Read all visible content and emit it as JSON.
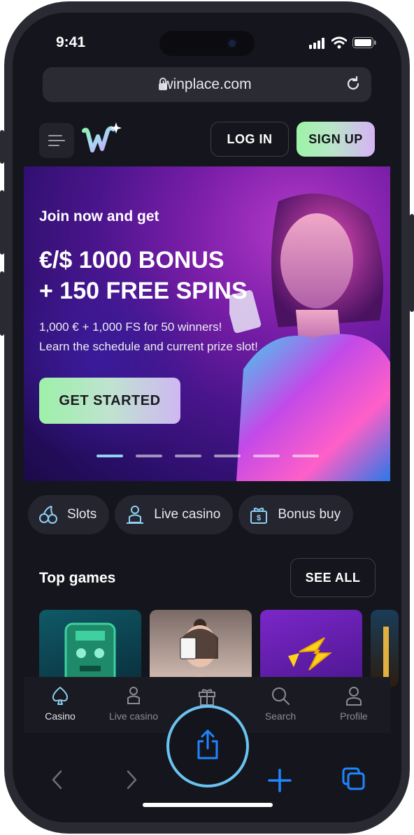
{
  "status_bar": {
    "time": "9:41"
  },
  "browser": {
    "url": "winplace.com"
  },
  "header": {
    "login_label": "LOG IN",
    "signup_label": "SIGN UP"
  },
  "hero": {
    "subtitle": "Join now and get",
    "title_line1": "€/$ 1000 BONUS",
    "title_line2": "+ 150 FREE SPINS",
    "desc_line1": "1,000 € + 1,000 FS for 50 winners!",
    "desc_line2": "Learn the schedule and current prize slot!",
    "cta_label": "GET STARTED",
    "slides_total": 6,
    "active_slide": 1
  },
  "categories": [
    {
      "label": "Slots",
      "icon": "cherries-icon"
    },
    {
      "label": "Live casino",
      "icon": "dealer-icon"
    },
    {
      "label": "Bonus buy",
      "icon": "gift-dollar-icon"
    }
  ],
  "top_games": {
    "title": "Top games",
    "see_all_label": "SEE ALL"
  },
  "bottom_nav": [
    {
      "label": "Casino",
      "icon": "spade-icon",
      "active": true
    },
    {
      "label": "Live casino",
      "icon": "dealer-icon",
      "active": false
    },
    {
      "label": "Promotions",
      "icon": "gift-icon",
      "active": false
    },
    {
      "label": "Search",
      "icon": "search-icon",
      "active": false
    },
    {
      "label": "Profile",
      "icon": "person-icon",
      "active": false
    }
  ],
  "colors": {
    "accent_green": "#9df3a7",
    "accent_purple": "#d6b3f5",
    "safari_blue": "#1f86ff",
    "highlight_ring": "#6ac3f0",
    "background": "#15161d"
  }
}
